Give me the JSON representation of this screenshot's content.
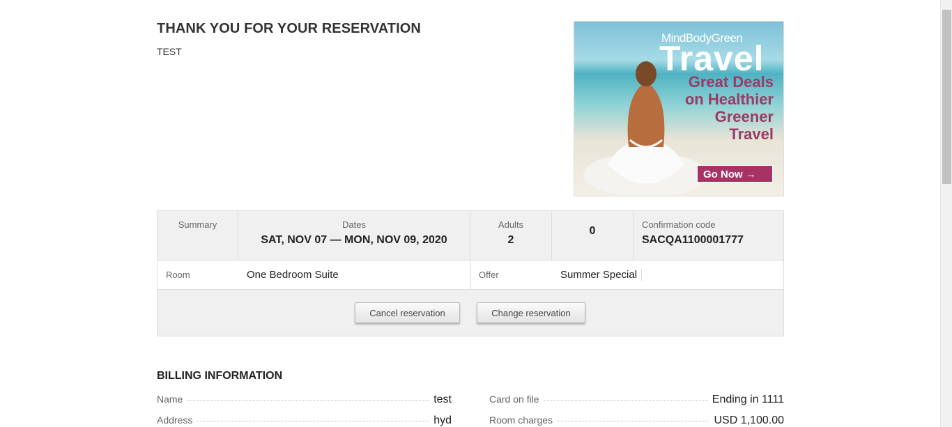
{
  "header": {
    "title": "THANK YOU FOR YOUR RESERVATION",
    "subtitle": "TEST"
  },
  "ad": {
    "brand": "MindBodyGreen",
    "headline": "Travel",
    "tagline_1": "Great Deals",
    "tagline_2": "on Healthier",
    "tagline_3": "Greener",
    "tagline_4": "Travel",
    "cta": "Go Now →"
  },
  "summary": {
    "summary_label": "Summary",
    "dates_label": "Dates",
    "dates_value": "SAT, NOV 07 — MON, NOV 09, 2020",
    "adults_label": "Adults",
    "adults_value": "2",
    "children_value": "0",
    "confirmation_label": "Confirmation code",
    "confirmation_value": "SACQA1100001777",
    "room_label": "Room",
    "room_value": "One Bedroom Suite",
    "offer_label": "Offer",
    "offer_value": "Summer Special",
    "cancel_button": "Cancel reservation",
    "change_button": "Change reservation"
  },
  "billing": {
    "heading": "BILLING INFORMATION",
    "name_label": "Name",
    "name_value": "test",
    "address_label": "Address",
    "address_value": "hyd",
    "card_label": "Card on file",
    "card_value": "Ending in 1111",
    "charges_label": "Room charges",
    "charges_value": "USD 1,100.00"
  },
  "colors": {
    "ad_accent": "#a73264",
    "panel_bg": "#f0f0f0",
    "border": "#dddddd"
  }
}
